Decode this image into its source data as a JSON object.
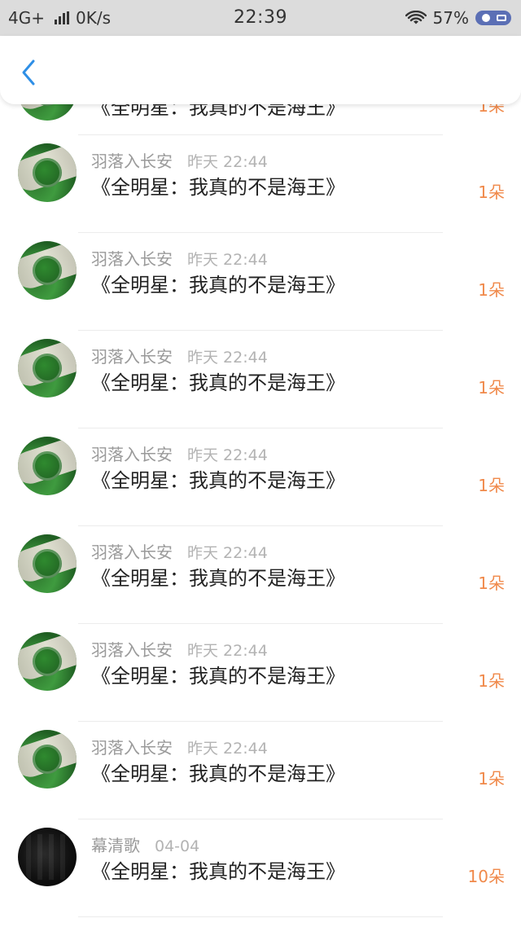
{
  "status_bar": {
    "network": "4G+",
    "speed": "0K/s",
    "time": "22:39",
    "battery_percent": "57%"
  },
  "header": {
    "back_icon": "chevron-left-icon"
  },
  "list": {
    "partial_top": {
      "title": "《全明星：我真的不是海王》",
      "amount": "1朵"
    },
    "items": [
      {
        "username": "羽落入长安",
        "time": "昨天 22:44",
        "title": "《全明星：我真的不是海王》",
        "amount": "1朵",
        "avatar": "green"
      },
      {
        "username": "羽落入长安",
        "time": "昨天 22:44",
        "title": "《全明星：我真的不是海王》",
        "amount": "1朵",
        "avatar": "green"
      },
      {
        "username": "羽落入长安",
        "time": "昨天 22:44",
        "title": "《全明星：我真的不是海王》",
        "amount": "1朵",
        "avatar": "green"
      },
      {
        "username": "羽落入长安",
        "time": "昨天 22:44",
        "title": "《全明星：我真的不是海王》",
        "amount": "1朵",
        "avatar": "green"
      },
      {
        "username": "羽落入长安",
        "time": "昨天 22:44",
        "title": "《全明星：我真的不是海王》",
        "amount": "1朵",
        "avatar": "green"
      },
      {
        "username": "羽落入长安",
        "time": "昨天 22:44",
        "title": "《全明星：我真的不是海王》",
        "amount": "1朵",
        "avatar": "green"
      },
      {
        "username": "羽落入长安",
        "time": "昨天 22:44",
        "title": "《全明星：我真的不是海王》",
        "amount": "1朵",
        "avatar": "green"
      },
      {
        "username": "幕清歌",
        "time": "04-04",
        "title": "《全明星：我真的不是海王》",
        "amount": "10朵",
        "avatar": "dark"
      }
    ]
  },
  "colors": {
    "amount": "#f0894a",
    "back_icon": "#2f8fe6",
    "status_bar_bg": "#dcdcdc"
  }
}
